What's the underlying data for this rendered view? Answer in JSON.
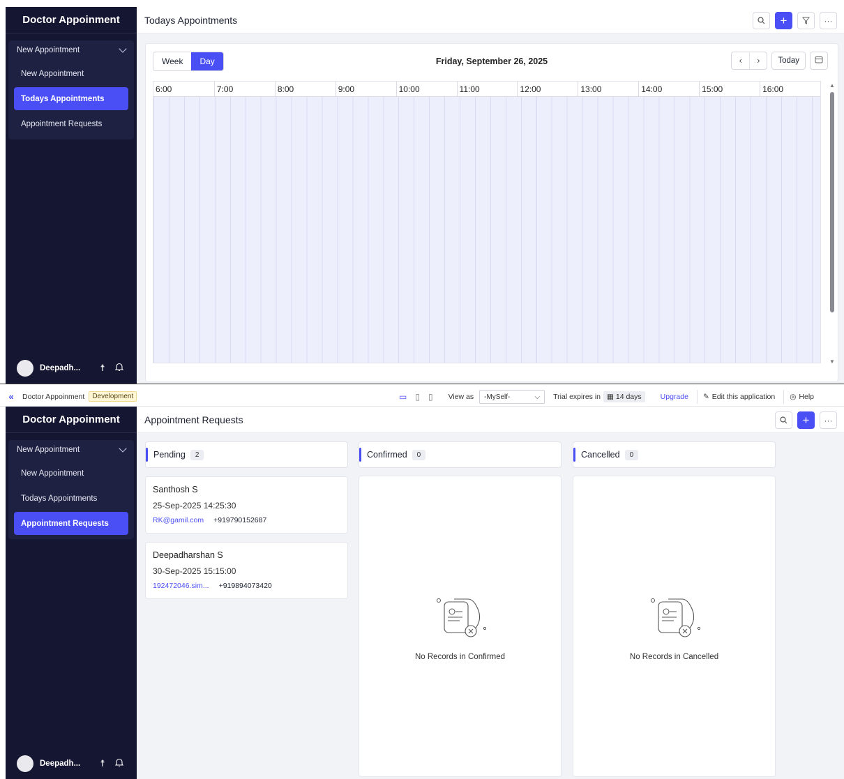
{
  "top": {
    "sidebar": {
      "title": "Doctor Appoinment",
      "group_label": "New Appointment",
      "items": [
        {
          "label": "New Appointment"
        },
        {
          "label": "Todays Appointments"
        },
        {
          "label": "Appointment Requests"
        }
      ],
      "active_index": 1,
      "user_name": "Deepadh..."
    },
    "header": {
      "title": "Todays Appointments"
    },
    "calendar": {
      "views": [
        "Week",
        "Day"
      ],
      "active_view": "Day",
      "date": "Friday, September 26, 2025",
      "today_label": "Today",
      "hours": [
        "6:00",
        "7:00",
        "8:00",
        "9:00",
        "10:00",
        "11:00",
        "12:00",
        "13:00",
        "14:00",
        "15:00",
        "16:00"
      ]
    }
  },
  "bottom": {
    "topbar": {
      "app_name": "Doctor Appoinment",
      "env": "Development",
      "view_as_label": "View as",
      "view_as_value": "-MySelf-",
      "trial_label": "Trial expires in",
      "trial_days": "14 days",
      "upgrade": "Upgrade",
      "edit": "Edit this application",
      "help": "Help"
    },
    "sidebar": {
      "title": "Doctor Appoinment",
      "group_label": "New Appointment",
      "items": [
        {
          "label": "New Appointment"
        },
        {
          "label": "Todays Appointments"
        },
        {
          "label": "Appointment Requests"
        }
      ],
      "active_index": 2,
      "user_name": "Deepadh..."
    },
    "header": {
      "title": "Appointment Requests"
    },
    "columns": [
      {
        "label": "Pending",
        "count": "2"
      },
      {
        "label": "Confirmed",
        "count": "0",
        "empty": "No Records in Confirmed"
      },
      {
        "label": "Cancelled",
        "count": "0",
        "empty": "No Records in Cancelled"
      }
    ],
    "cards": [
      {
        "name": "Santhosh S",
        "datetime": "25-Sep-2025 14:25:30",
        "email": "RK@gamil.com",
        "phone": "+919790152687"
      },
      {
        "name": "Deepadharshan S",
        "datetime": "30-Sep-2025 15:15:00",
        "email": "192472046.sim...",
        "phone": "+919894073420"
      }
    ]
  },
  "colors": {
    "accent": "#4a4ff5",
    "sidebar_bg": "#151631",
    "slot_bg": "#eeeffd"
  },
  "icons": [
    "search-icon",
    "plus-icon",
    "filter-icon",
    "more-icon",
    "chevron-left-icon",
    "chevron-right-icon",
    "calendar-icon",
    "accessibility-icon",
    "bell-icon",
    "desktop-icon",
    "tablet-icon",
    "mobile-icon",
    "pencil-icon",
    "help-icon",
    "no-records-icon"
  ]
}
